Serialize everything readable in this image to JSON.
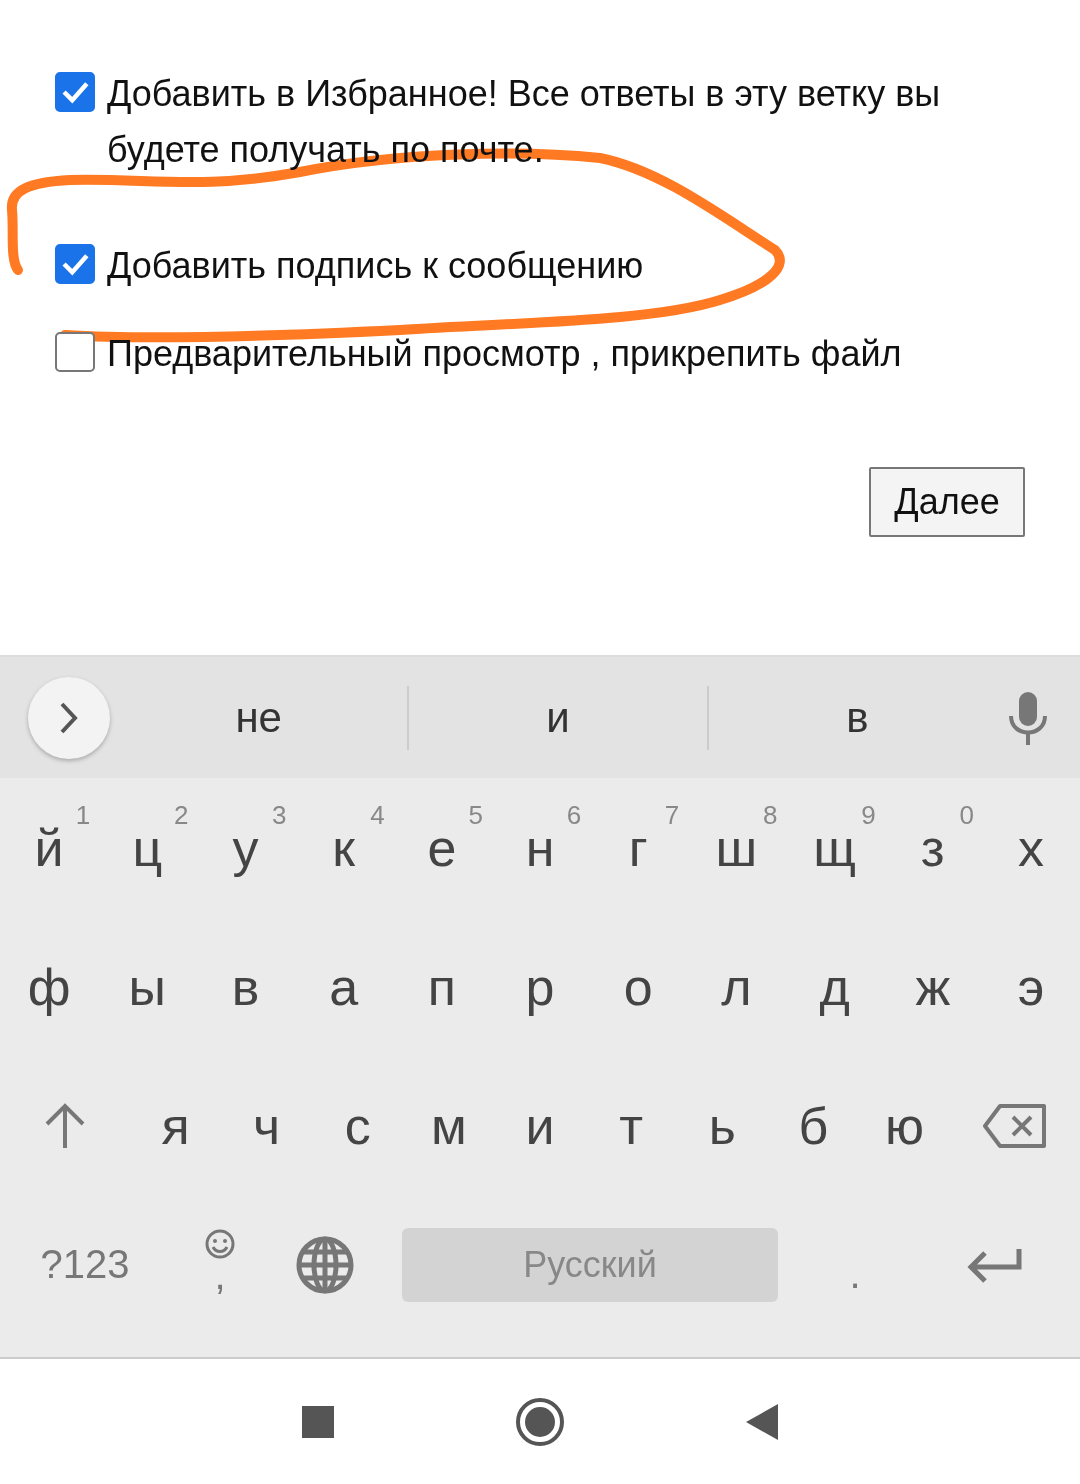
{
  "options": [
    {
      "label": "Добавить в Избранное! Все ответы в эту ветку вы будете получать по почте.",
      "checked": true
    },
    {
      "label": "Добавить подпись к сообщению",
      "checked": true
    },
    {
      "label": "Предварительный просмотр , прикрепить файл",
      "checked": false
    }
  ],
  "next_button": {
    "label": "Далее"
  },
  "keyboard": {
    "suggestions": [
      "не",
      "и",
      "в"
    ],
    "rows": [
      [
        {
          "char": "й",
          "hint": "1"
        },
        {
          "char": "ц",
          "hint": "2"
        },
        {
          "char": "у",
          "hint": "3"
        },
        {
          "char": "к",
          "hint": "4"
        },
        {
          "char": "е",
          "hint": "5"
        },
        {
          "char": "н",
          "hint": "6"
        },
        {
          "char": "г",
          "hint": "7"
        },
        {
          "char": "ш",
          "hint": "8"
        },
        {
          "char": "щ",
          "hint": "9"
        },
        {
          "char": "з",
          "hint": "0"
        },
        {
          "char": "х"
        }
      ],
      [
        {
          "char": "ф"
        },
        {
          "char": "ы"
        },
        {
          "char": "в"
        },
        {
          "char": "а"
        },
        {
          "char": "п"
        },
        {
          "char": "р"
        },
        {
          "char": "о"
        },
        {
          "char": "л"
        },
        {
          "char": "д"
        },
        {
          "char": "ж"
        },
        {
          "char": "э"
        }
      ],
      [
        {
          "kind": "shift"
        },
        {
          "char": "я"
        },
        {
          "char": "ч"
        },
        {
          "char": "с"
        },
        {
          "char": "м"
        },
        {
          "char": "и"
        },
        {
          "char": "т"
        },
        {
          "char": "ь"
        },
        {
          "char": "б"
        },
        {
          "char": "ю"
        },
        {
          "kind": "backspace"
        }
      ]
    ],
    "symbols_key": "?123",
    "comma_key": ",",
    "space_label": "Русский",
    "period_key": "."
  }
}
